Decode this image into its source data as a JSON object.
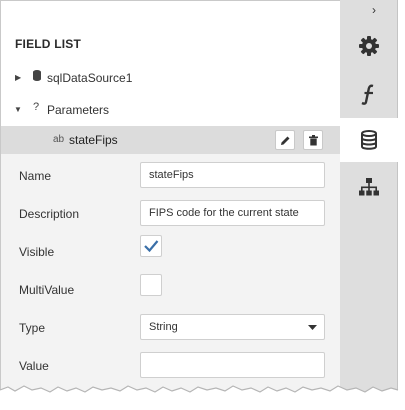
{
  "panel": {
    "title": "FIELD LIST",
    "tree": [
      {
        "label": "sqlDataSource1",
        "icon": "database-icon",
        "caret": "▶"
      },
      {
        "label": "Parameters",
        "icon": "question-icon",
        "caret": "▼"
      }
    ],
    "parameter": {
      "type_glyph": "ab",
      "label": "stateFips"
    }
  },
  "properties": {
    "name": {
      "label": "Name",
      "value": "stateFips"
    },
    "description": {
      "label": "Description",
      "value": "FIPS code for the current state"
    },
    "visible": {
      "label": "Visible",
      "checked": true
    },
    "multivalue": {
      "label": "MultiValue",
      "checked": false
    },
    "type": {
      "label": "Type",
      "value": "String"
    },
    "value": {
      "label": "Value",
      "value": ""
    }
  },
  "sidebar": {
    "collapse_glyph": "›",
    "tabs": [
      "gear-icon",
      "function-icon",
      "database-icon",
      "hierarchy-icon"
    ],
    "active_tab": "database-icon"
  },
  "colors": {
    "accent_check": "#3a6fa8",
    "selection": "#dcdcdc",
    "sidebar": "#dedede"
  }
}
